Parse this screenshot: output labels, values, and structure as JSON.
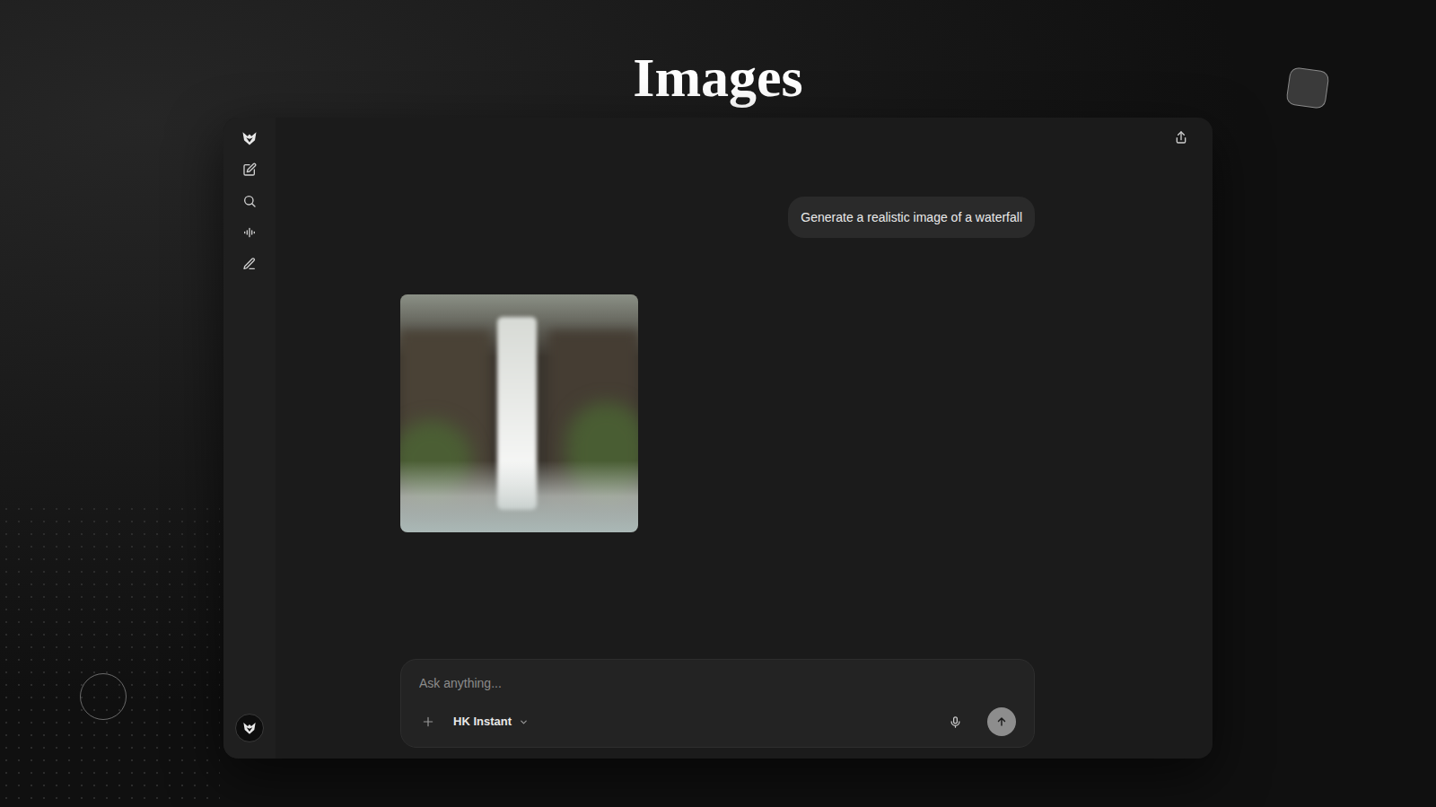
{
  "page": {
    "title": "Images"
  },
  "chat": {
    "messages": [
      {
        "role": "user",
        "kind": "text",
        "text": "Generate a realistic image of a waterfall"
      },
      {
        "role": "assistant",
        "kind": "image"
      }
    ]
  },
  "composer": {
    "placeholder": "Ask anything...",
    "model": "HK Instant"
  }
}
